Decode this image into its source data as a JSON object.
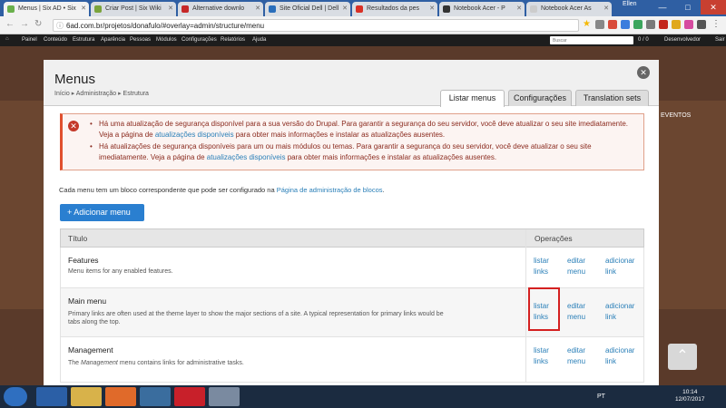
{
  "browser": {
    "tabs": [
      {
        "label": "Menus | Six AD • Six",
        "color": "#6ab04c"
      },
      {
        "label": "Criar Post | Six Wiki",
        "color": "#7aa33b"
      },
      {
        "label": "Alternative downlo",
        "color": "#c62828"
      },
      {
        "label": "Site Oficial Dell | Dell",
        "color": "#2a6ebb"
      },
      {
        "label": "Resultados da pes",
        "color": "#d93025"
      },
      {
        "label": "Notebook Acer - P",
        "color": "#333333"
      },
      {
        "label": "Notebook Acer As",
        "color": "#cccccc"
      }
    ],
    "profile": "Ellen",
    "url": "6ad.com.br/projetos/donafulo/#overlay=admin/structure/menu"
  },
  "toolbar": {
    "items": [
      "Painel",
      "Conteúdo",
      "Estrutura",
      "Aparência",
      "Pessoas",
      "Módulos",
      "Configurações",
      "Relatórios",
      "Ajuda"
    ],
    "search_placeholder": "Buscar",
    "counter": "0 / 0",
    "user": "Desenvolvedor",
    "logout": "Sair"
  },
  "background": {
    "link": "EVENTOS"
  },
  "modal": {
    "title": "Menus",
    "breadcrumb": [
      "Início",
      "Administração",
      "Estrutura"
    ],
    "breadcrumb_sep": "▸",
    "tabs": [
      "Listar menus",
      "Configurações",
      "Translation sets"
    ],
    "alerts": [
      {
        "before": "Há uma atualização de segurança disponível para a sua versão do Drupal. Para garantir a segurança do seu servidor, você deve atualizar o seu site imediatamente. Veja a página de ",
        "link": "atualizações disponíveis",
        "after": " para obter mais informações e instalar as atualizações ausentes."
      },
      {
        "before": "Há atualizações de segurança disponíveis para um ou mais módulos ou temas. Para garantir a segurança do seu servidor, você deve atualizar o seu site imediatamente. Veja a página de ",
        "link": "atualizações disponíveis",
        "after": " para obter mais informações e instalar as atualizações ausentes."
      }
    ],
    "intro_text": "Cada menu tem um bloco correspondente que pode ser configurado na ",
    "intro_link": "Página de administração de blocos",
    "intro_end": ".",
    "add_button": "+  Adicionar menu",
    "table": {
      "headers": [
        "Título",
        "Operações"
      ],
      "rows": [
        {
          "title": "Features",
          "description": "Menu items for any enabled features."
        },
        {
          "title": "Main menu",
          "description": "Primary links are often used at the theme layer to show the major sections of a site. A typical representation for primary links would be tabs along the top."
        },
        {
          "title": "Management",
          "description_pre": "The ",
          "description_em": "Management",
          "description_post": " menu contains links for administrative tasks."
        }
      ],
      "ops": [
        "listar links",
        "editar menu",
        "adicionar link"
      ]
    }
  },
  "scroll_up": "⌃",
  "taskbar": {
    "language": "PT",
    "time": "10:14",
    "date": "12/07/2017"
  }
}
